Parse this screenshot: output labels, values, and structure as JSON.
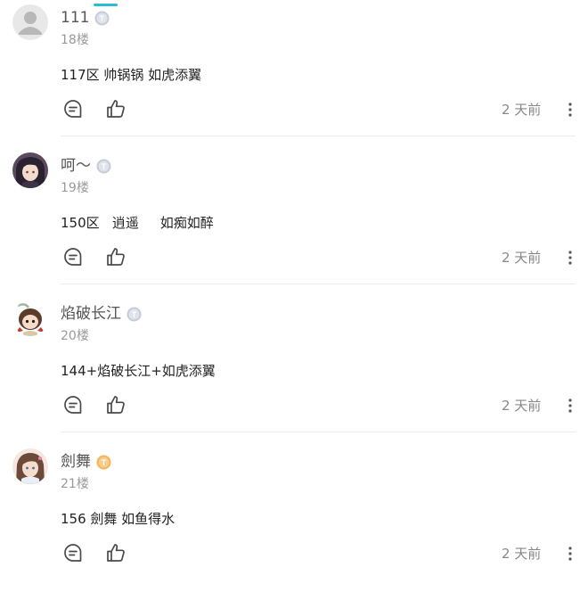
{
  "colors": {
    "accent": "#2bbcd0",
    "badge_gray": "#c5ccd9",
    "badge_gold": "#f2b45c",
    "text_primary": "#222222",
    "text_muted": "#999999",
    "icon": "#4a4a4a"
  },
  "comments": [
    {
      "username": "111",
      "floor": "18楼",
      "content": "117区 帅锅锅 如虎添翼",
      "timestamp": "2 天前",
      "badge_letter": "T",
      "badge_color": "gray",
      "avatar": "default-avatar-icon"
    },
    {
      "username": "呵～",
      "floor": "19楼",
      "content": "150区   逍遥     如痴如醉",
      "timestamp": "2 天前",
      "badge_letter": "T",
      "badge_color": "gray",
      "avatar": "dark-haired-girl-avatar"
    },
    {
      "username": "焰破长江",
      "floor": "20楼",
      "content": "144+焰破长江+如虎添翼",
      "timestamp": "2 天前",
      "badge_letter": "T",
      "badge_color": "gray",
      "avatar": "chibi-character-avatar"
    },
    {
      "username": "劍舞",
      "floor": "21楼",
      "content": "156 劍舞 如鱼得水",
      "timestamp": "2 天前",
      "badge_letter": "T",
      "badge_color": "gold",
      "avatar": "anime-girl-avatar"
    }
  ]
}
